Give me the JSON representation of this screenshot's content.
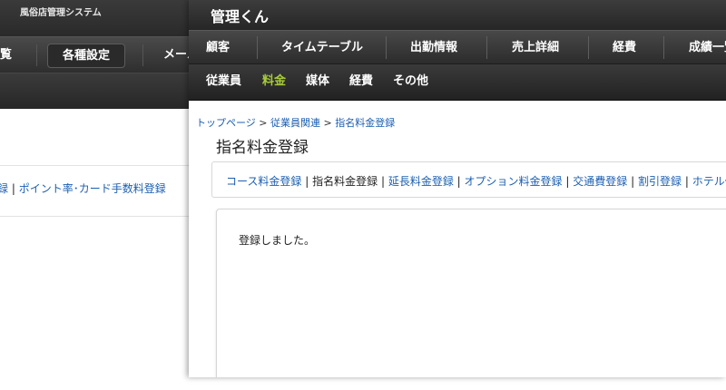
{
  "back_window": {
    "app_title": "風俗店管理システム",
    "nav": [
      "覧",
      "各種設定",
      "メール"
    ],
    "links": [
      "録",
      "ポイント率･カード手数料登録"
    ]
  },
  "front_window": {
    "app_title": "管理くん",
    "nav": [
      "顧客",
      "タイムテーブル",
      "出勤情報",
      "売上詳細",
      "経費",
      "成績一覧"
    ],
    "subnav": [
      "従業員",
      "料金",
      "媒体",
      "経費",
      "その他"
    ],
    "subnav_active": "料金",
    "breadcrumb": [
      "トップページ",
      "従業員関連",
      "指名料金登録"
    ],
    "breadcrumb_separator": ">",
    "page_title": "指名料金登録",
    "tabs": [
      "コース料金登録",
      "指名料金登録",
      "延長料金登録",
      "オプション料金登録",
      "交通費登録",
      "割引登録",
      "ホテル代登録"
    ],
    "tab_separator": "|",
    "message": "登録しました。"
  },
  "colors": {
    "header_dark": "#2a2a2a",
    "link_blue": "#1c5fb0",
    "active_green": "#a8cc3a"
  }
}
